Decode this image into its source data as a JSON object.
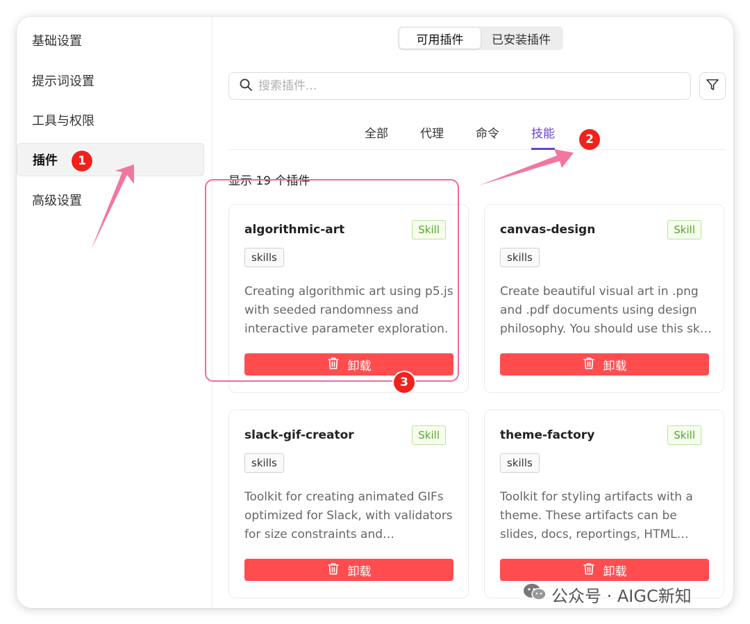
{
  "sidebar": {
    "items": [
      {
        "label": "基础设置"
      },
      {
        "label": "提示词设置"
      },
      {
        "label": "工具与权限"
      },
      {
        "label": "插件"
      },
      {
        "label": "高级设置"
      }
    ],
    "active_index": 3
  },
  "segmented": {
    "available": "可用插件",
    "installed": "已安装插件",
    "active": "available"
  },
  "search": {
    "placeholder": "搜索插件..."
  },
  "category_tabs": [
    {
      "label": "全部"
    },
    {
      "label": "代理"
    },
    {
      "label": "命令"
    },
    {
      "label": "技能"
    }
  ],
  "active_category": "技能",
  "plugin_count_text": "显示 19 个插件",
  "plugins": [
    {
      "name": "algorithmic-art",
      "type": "Skill",
      "tag": "skills",
      "description": "Creating algorithmic art using p5.js with seeded randomness and interactive parameter exploration.",
      "action": "卸载"
    },
    {
      "name": "canvas-design",
      "type": "Skill",
      "tag": "skills",
      "description": "Create beautiful visual art in .png and .pdf documents using design philosophy. You should use this skill when the user asks to create a poster.",
      "action": "卸载"
    },
    {
      "name": "slack-gif-creator",
      "type": "Skill",
      "tag": "skills",
      "description": "Toolkit for creating animated GIFs optimized for Slack, with validators for size constraints and composable animation primitives.",
      "action": "卸载"
    },
    {
      "name": "theme-factory",
      "type": "Skill",
      "tag": "skills",
      "description": "Toolkit for styling artifacts with a theme. These artifacts can be slides, docs, reportings, HTML landing pages, etc.",
      "action": "卸载"
    }
  ],
  "annotations": {
    "one": "1",
    "two": "2",
    "three": "3"
  },
  "watermark": {
    "text": "公众号 · AIGC新知"
  },
  "colors": {
    "accent": "#6b3fd4",
    "danger": "#ff4d4f",
    "skill_green": "#52a52a",
    "badge_red": "#f0221b",
    "arrow_pink": "#f06a9a"
  }
}
